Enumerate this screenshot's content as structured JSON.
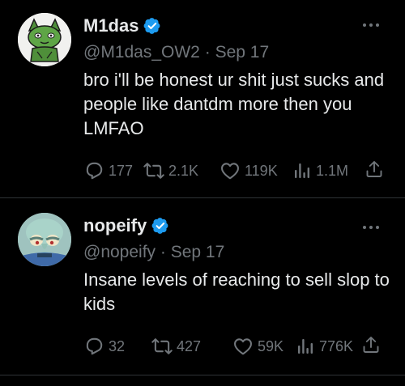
{
  "colors": {
    "background": "#000000",
    "text": "#e7e9ea",
    "muted": "#71767b",
    "verified": "#1d9bf0",
    "divider": "#2f3336"
  },
  "tweets": [
    {
      "display_name": "M1das",
      "handle": "@M1das_OW2",
      "separator": "·",
      "date": "Sep 17",
      "text": "bro i'll be honest ur shit just sucks and people like dantdm more then you LMFAO",
      "avatar_icon": "green-cat-avatar",
      "verified_icon": "verified-badge-icon",
      "stats": {
        "replies": "177",
        "reposts": "2.1K",
        "likes": "119K",
        "views": "1.1M"
      }
    },
    {
      "display_name": "nopeify",
      "handle": "@nopeify",
      "separator": "·",
      "date": "Sep 17",
      "text": "Insane levels of reaching to sell slop to kids",
      "avatar_icon": "squidward-avatar",
      "verified_icon": "verified-badge-icon",
      "stats": {
        "replies": "32",
        "reposts": "427",
        "likes": "59K",
        "views": "776K"
      }
    }
  ]
}
